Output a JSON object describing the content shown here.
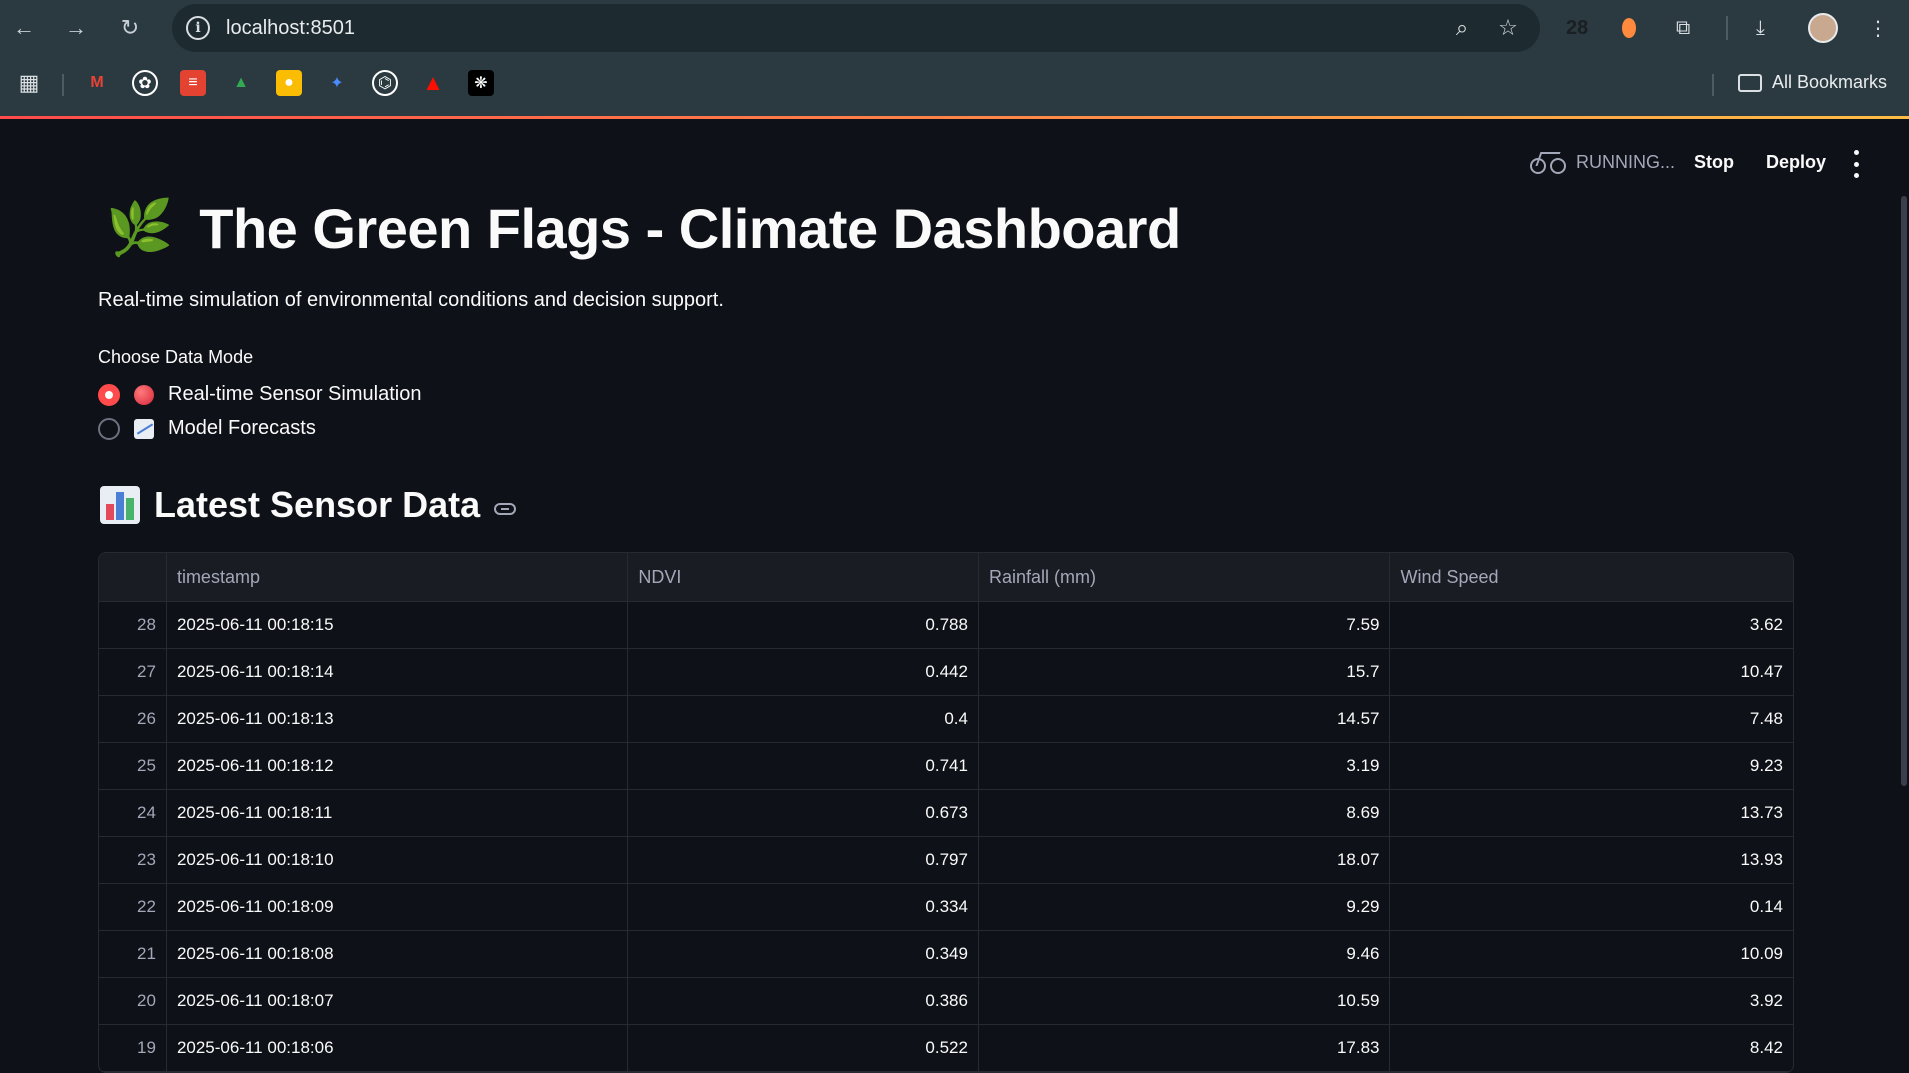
{
  "browser": {
    "url": "localhost:8501",
    "extension_count": "28",
    "all_bookmarks_label": "All Bookmarks"
  },
  "bookmarks": [
    {
      "icon": "apps-grid-icon"
    },
    {
      "icon": "gmail-icon"
    },
    {
      "icon": "chatgpt-icon"
    },
    {
      "icon": "todoist-icon"
    },
    {
      "icon": "google-drive-icon"
    },
    {
      "icon": "google-keep-icon"
    },
    {
      "icon": "gemini-icon"
    },
    {
      "icon": "github-icon"
    },
    {
      "icon": "adobe-icon"
    },
    {
      "icon": "perplexity-icon"
    }
  ],
  "streamlit_header": {
    "status": "RUNNING...",
    "stop_label": "Stop",
    "deploy_label": "Deploy"
  },
  "page": {
    "title_emoji": "🌿",
    "title": "The Green Flags - Climate Dashboard",
    "subtitle": "Real-time simulation of environmental conditions and decision support.",
    "data_mode": {
      "label": "Choose Data Mode",
      "options": [
        {
          "label": "Real-time Sensor Simulation",
          "selected": true,
          "icon": "red-circle-icon"
        },
        {
          "label": "Model Forecasts",
          "selected": false,
          "icon": "chart-increasing-icon"
        }
      ]
    },
    "section_title": "Latest Sensor Data"
  },
  "table": {
    "columns": [
      "",
      "timestamp",
      "NDVI",
      "Rainfall (mm)",
      "Wind Speed"
    ],
    "rows": [
      [
        "28",
        "2025-06-11 00:18:15",
        "0.788",
        "7.59",
        "3.62"
      ],
      [
        "27",
        "2025-06-11 00:18:14",
        "0.442",
        "15.7",
        "10.47"
      ],
      [
        "26",
        "2025-06-11 00:18:13",
        "0.4",
        "14.57",
        "7.48"
      ],
      [
        "25",
        "2025-06-11 00:18:12",
        "0.741",
        "3.19",
        "9.23"
      ],
      [
        "24",
        "2025-06-11 00:18:11",
        "0.673",
        "8.69",
        "13.73"
      ],
      [
        "23",
        "2025-06-11 00:18:10",
        "0.797",
        "18.07",
        "13.93"
      ],
      [
        "22",
        "2025-06-11 00:18:09",
        "0.334",
        "9.29",
        "0.14"
      ],
      [
        "21",
        "2025-06-11 00:18:08",
        "0.349",
        "9.46",
        "10.09"
      ],
      [
        "20",
        "2025-06-11 00:18:07",
        "0.386",
        "10.59",
        "3.92"
      ],
      [
        "19",
        "2025-06-11 00:18:06",
        "0.522",
        "17.83",
        "8.42"
      ]
    ]
  },
  "colors": {
    "background": "#0e1117",
    "accent": "#ff4b4b",
    "chrome": "#2b3a40"
  }
}
